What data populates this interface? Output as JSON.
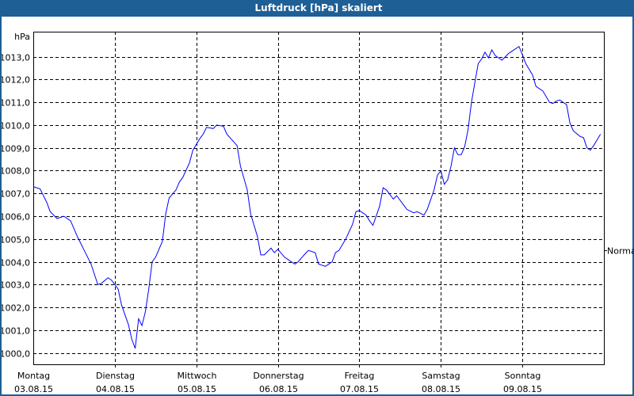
{
  "window": {
    "title": "Luftdruck [hPa] skaliert",
    "title_bar_color": "#1e5f96"
  },
  "chart_data": {
    "type": "line",
    "title": "Luftdruck [hPa] skaliert",
    "ylabel": "hPa",
    "ylim": [
      999.5,
      1014.1
    ],
    "yticks": [
      1000,
      1001,
      1002,
      1003,
      1004,
      1005,
      1006,
      1007,
      1008,
      1009,
      1010,
      1011,
      1012,
      1013
    ],
    "ytick_labels": [
      "1000,0",
      "1001,0",
      "1002,0",
      "1003,0",
      "1004,0",
      "1005,0",
      "1006,0",
      "1007,0",
      "1008,0",
      "1009,0",
      "1010,0",
      "1011,0",
      "1012,0",
      "1013,0"
    ],
    "xlim": [
      "2015-08-03 00:00",
      "2015-08-10 00:00"
    ],
    "xticks": [
      {
        "day": "Montag",
        "date": "03.08.15"
      },
      {
        "day": "Dienstag",
        "date": "04.08.15"
      },
      {
        "day": "Mittwoch",
        "date": "05.08.15"
      },
      {
        "day": "Donnerstag",
        "date": "06.08.15"
      },
      {
        "day": "Freitag",
        "date": "07.08.15"
      },
      {
        "day": "Samstag",
        "date": "08.08.15"
      },
      {
        "day": "Sonntag",
        "date": "09.08.15"
      }
    ],
    "grid": true,
    "reference": {
      "label": "Normal",
      "value": 1004.5
    },
    "series": [
      {
        "color": "#0000ff",
        "points": [
          [
            "2015-08-03 00:00",
            1007.3
          ],
          [
            "2015-08-03 02:00",
            1007.2
          ],
          [
            "2015-08-03 04:00",
            1006.6
          ],
          [
            "2015-08-03 05:00",
            1006.2
          ],
          [
            "2015-08-03 07:00",
            1005.9
          ],
          [
            "2015-08-03 09:00",
            1006.0
          ],
          [
            "2015-08-03 11:00",
            1005.8
          ],
          [
            "2015-08-03 13:00",
            1005.1
          ],
          [
            "2015-08-03 15:00",
            1004.5
          ],
          [
            "2015-08-03 17:00",
            1003.9
          ],
          [
            "2015-08-03 19:00",
            1003.0
          ],
          [
            "2015-08-03 20:00",
            1003.05
          ],
          [
            "2015-08-03 22:00",
            1003.3
          ],
          [
            "2015-08-03 23:00",
            1003.2
          ],
          [
            "2015-08-04 01:00",
            1002.8
          ],
          [
            "2015-08-04 02:00",
            1002.1
          ],
          [
            "2015-08-04 04:00",
            1001.25
          ],
          [
            "2015-08-04 05:00",
            1000.6
          ],
          [
            "2015-08-04 06:00",
            1000.2
          ],
          [
            "2015-08-04 07:00",
            1001.5
          ],
          [
            "2015-08-04 08:00",
            1001.2
          ],
          [
            "2015-08-04 09:00",
            1001.8
          ],
          [
            "2015-08-04 10:00",
            1002.8
          ],
          [
            "2015-08-04 11:00",
            1004.0
          ],
          [
            "2015-08-04 12:00",
            1004.2
          ],
          [
            "2015-08-04 14:00",
            1004.9
          ],
          [
            "2015-08-04 15:00",
            1006.1
          ],
          [
            "2015-08-04 16:00",
            1006.8
          ],
          [
            "2015-08-04 18:00",
            1007.15
          ],
          [
            "2015-08-04 19:00",
            1007.5
          ],
          [
            "2015-08-04 20:00",
            1007.7
          ],
          [
            "2015-08-04 22:00",
            1008.35
          ],
          [
            "2015-08-04 23:00",
            1008.9
          ],
          [
            "2015-08-05 01:00",
            1009.4
          ],
          [
            "2015-08-05 02:00",
            1009.6
          ],
          [
            "2015-08-05 03:00",
            1009.9
          ],
          [
            "2015-08-05 05:00",
            1009.85
          ],
          [
            "2015-08-05 06:00",
            1010.0
          ],
          [
            "2015-08-05 08:00",
            1009.95
          ],
          [
            "2015-08-05 09:00",
            1009.6
          ],
          [
            "2015-08-05 12:00",
            1009.1
          ],
          [
            "2015-08-05 13:00",
            1008.2
          ],
          [
            "2015-08-05 15:00",
            1007.15
          ],
          [
            "2015-08-05 16:00",
            1006.1
          ],
          [
            "2015-08-05 18:00",
            1005.1
          ],
          [
            "2015-08-05 19:00",
            1004.3
          ],
          [
            "2015-08-05 20:00",
            1004.3
          ],
          [
            "2015-08-05 22:00",
            1004.6
          ],
          [
            "2015-08-05 23:00",
            1004.4
          ],
          [
            "2015-08-06 00:00",
            1004.55
          ],
          [
            "2015-08-06 02:00",
            1004.2
          ],
          [
            "2015-08-06 03:00",
            1004.1
          ],
          [
            "2015-08-06 05:00",
            1003.9
          ],
          [
            "2015-08-06 06:00",
            1004.0
          ],
          [
            "2015-08-06 08:00",
            1004.35
          ],
          [
            "2015-08-06 09:00",
            1004.5
          ],
          [
            "2015-08-06 11:00",
            1004.4
          ],
          [
            "2015-08-06 12:00",
            1003.9
          ],
          [
            "2015-08-06 14:00",
            1003.8
          ],
          [
            "2015-08-06 16:00",
            1004.0
          ],
          [
            "2015-08-06 17:00",
            1004.4
          ],
          [
            "2015-08-06 18:00",
            1004.5
          ],
          [
            "2015-08-06 20:00",
            1005.0
          ],
          [
            "2015-08-06 22:00",
            1005.65
          ],
          [
            "2015-08-06 23:00",
            1006.2
          ],
          [
            "2015-08-07 00:00",
            1006.25
          ],
          [
            "2015-08-07 02:00",
            1006.05
          ],
          [
            "2015-08-07 03:00",
            1005.8
          ],
          [
            "2015-08-07 04:00",
            1005.6
          ],
          [
            "2015-08-07 06:00",
            1006.45
          ],
          [
            "2015-08-07 07:00",
            1007.25
          ],
          [
            "2015-08-07 08:00",
            1007.15
          ],
          [
            "2015-08-07 10:00",
            1006.75
          ],
          [
            "2015-08-07 11:00",
            1006.9
          ],
          [
            "2015-08-07 13:00",
            1006.5
          ],
          [
            "2015-08-07 14:00",
            1006.3
          ],
          [
            "2015-08-07 16:00",
            1006.15
          ],
          [
            "2015-08-07 17:00",
            1006.2
          ],
          [
            "2015-08-07 19:00",
            1006.05
          ],
          [
            "2015-08-07 20:00",
            1006.3
          ],
          [
            "2015-08-07 22:00",
            1007.15
          ],
          [
            "2015-08-07 23:00",
            1007.8
          ],
          [
            "2015-08-08 00:00",
            1008.0
          ],
          [
            "2015-08-08 01:00",
            1007.4
          ],
          [
            "2015-08-08 02:00",
            1007.6
          ],
          [
            "2015-08-08 03:00",
            1008.2
          ],
          [
            "2015-08-08 04:00",
            1009.0
          ],
          [
            "2015-08-08 05:00",
            1008.7
          ],
          [
            "2015-08-08 06:00",
            1008.7
          ],
          [
            "2015-08-08 07:00",
            1009.05
          ],
          [
            "2015-08-08 08:00",
            1009.8
          ],
          [
            "2015-08-08 09:00",
            1011.0
          ],
          [
            "2015-08-08 10:00",
            1011.85
          ],
          [
            "2015-08-08 11:00",
            1012.7
          ],
          [
            "2015-08-08 12:00",
            1012.9
          ],
          [
            "2015-08-08 13:00",
            1013.2
          ],
          [
            "2015-08-08 14:00",
            1012.95
          ],
          [
            "2015-08-08 15:00",
            1013.3
          ],
          [
            "2015-08-08 16:00",
            1013.05
          ],
          [
            "2015-08-08 18:00",
            1012.85
          ],
          [
            "2015-08-08 20:00",
            1013.15
          ],
          [
            "2015-08-08 23:00",
            1013.45
          ],
          [
            "2015-08-09 00:00",
            1013.1
          ],
          [
            "2015-08-09 01:00",
            1012.7
          ],
          [
            "2015-08-09 03:00",
            1012.2
          ],
          [
            "2015-08-09 04:00",
            1011.7
          ],
          [
            "2015-08-09 06:00",
            1011.5
          ],
          [
            "2015-08-09 08:00",
            1011.0
          ],
          [
            "2015-08-09 09:00",
            1010.95
          ],
          [
            "2015-08-09 10:00",
            1011.05
          ],
          [
            "2015-08-09 11:00",
            1011.1
          ],
          [
            "2015-08-09 13:00",
            1010.9
          ],
          [
            "2015-08-09 14:00",
            1010.1
          ],
          [
            "2015-08-09 15:00",
            1009.75
          ],
          [
            "2015-08-09 17:00",
            1009.5
          ],
          [
            "2015-08-09 18:00",
            1009.45
          ],
          [
            "2015-08-09 19:00",
            1009.0
          ],
          [
            "2015-08-09 20:00",
            1008.9
          ],
          [
            "2015-08-09 21:00",
            1009.1
          ],
          [
            "2015-08-09 22:00",
            1009.35
          ],
          [
            "2015-08-09 23:00",
            1009.6
          ]
        ]
      }
    ]
  }
}
